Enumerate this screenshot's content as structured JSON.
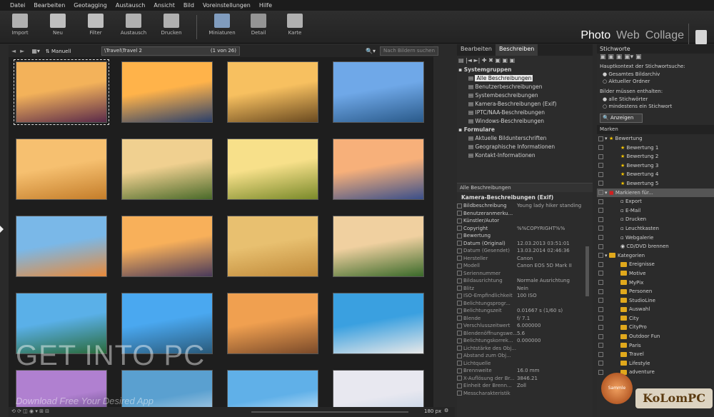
{
  "menu": [
    "Datei",
    "Bearbeiten",
    "Geotagging",
    "Austausch",
    "Ansicht",
    "Bild",
    "Voreinstellungen",
    "Hilfe"
  ],
  "toolbar": [
    {
      "label": "Import",
      "icon": "import-icon"
    },
    {
      "label": "Neu",
      "icon": "new-folder-icon"
    },
    {
      "label": "Filter",
      "icon": "filter-icon"
    },
    {
      "label": "Austausch",
      "icon": "exchange-icon"
    },
    {
      "label": "Drucken",
      "icon": "print-icon"
    },
    {
      "label": "Miniaturen",
      "icon": "thumbnails-icon"
    },
    {
      "label": "Detail",
      "icon": "detail-icon"
    },
    {
      "label": "Karte",
      "icon": "map-icon"
    }
  ],
  "modes": {
    "photo": "Photo",
    "web": "Web",
    "collage": "Collage"
  },
  "nav": {
    "sort": "Manuell",
    "path": "\\Travel\\Travel 2",
    "count": "(1 von 26)",
    "search_placeholder": "Nach Bildern suchen"
  },
  "thumbs": [
    {
      "c1": "#f3b25a",
      "c2": "#5a2a4a"
    },
    {
      "c1": "#ffb34a",
      "c2": "#2a3f6a"
    },
    {
      "c1": "#f7c060",
      "c2": "#6a4a20"
    },
    {
      "c1": "#6fa8e8",
      "c2": "#2a5a8a"
    },
    {
      "c1": "#f6c070",
      "c2": "#c47d2a"
    },
    {
      "c1": "#f0d090",
      "c2": "#4a6a2a"
    },
    {
      "c1": "#f7e08a",
      "c2": "#7a8a2a"
    },
    {
      "c1": "#f7b07a",
      "c2": "#3a4f8a"
    },
    {
      "c1": "#7ab8e8",
      "c2": "#e88a3a"
    },
    {
      "c1": "#f8b05a",
      "c2": "#4a3a5a"
    },
    {
      "c1": "#e8c070",
      "c2": "#c08a3a"
    },
    {
      "c1": "#f0d0a0",
      "c2": "#3a6a2a"
    },
    {
      "c1": "#5ab0e8",
      "c2": "#2a6a3a"
    },
    {
      "c1": "#4aa8f0",
      "c2": "#2a5a7a"
    },
    {
      "c1": "#f0a050",
      "c2": "#7a4a2a"
    },
    {
      "c1": "#3aa0e0",
      "c2": "#e8e8e8"
    },
    {
      "c1": "#b080d0",
      "c2": "#3a2a5a"
    },
    {
      "c1": "#5aa0d0",
      "c2": "#e0e8f0"
    },
    {
      "c1": "#60b0e8",
      "c2": "#ffffff"
    },
    {
      "c1": "#e8e8f0",
      "c2": "#b0c8e0"
    }
  ],
  "tabs": {
    "edit": "Bearbeiten",
    "describe": "Beschreiben"
  },
  "tree": [
    {
      "t": "Systemgruppen",
      "lvl": 0
    },
    {
      "t": "Alle Beschreibungen",
      "lvl": 1,
      "sel": true
    },
    {
      "t": "Benutzerbeschreibungen",
      "lvl": 1
    },
    {
      "t": "Systembeschreibungen",
      "lvl": 1
    },
    {
      "t": "Kamera-Beschreibungen (Exif)",
      "lvl": 1
    },
    {
      "t": "IPTC/NAA-Beschreibungen",
      "lvl": 1
    },
    {
      "t": "Windows-Beschreibungen",
      "lvl": 1
    },
    {
      "t": "Formulare",
      "lvl": 0
    },
    {
      "t": "Aktuelle Bildunterschriften",
      "lvl": 1
    },
    {
      "t": "Geographische Informationen",
      "lvl": 1
    },
    {
      "t": "Kontakt-Informationen",
      "lvl": 1
    }
  ],
  "all_desc": "Alle Beschreibungen",
  "exif_header": "Kamera-Beschreibungen (Exif)",
  "exif": [
    [
      "Bildbeschreibung",
      "Young lady hiker standing"
    ],
    [
      "Benutzeranmerku...",
      ""
    ],
    [
      "Künstler/Autor",
      ""
    ],
    [
      "Copyright",
      "%%COPYRIGHT%%"
    ],
    [
      "Bewertung",
      ""
    ],
    [
      "Datum (Original)",
      "12.03.2013 03:51:01"
    ],
    [
      "Datum (Gesendet)",
      "13.03.2014 02:46:36"
    ],
    [
      "Hersteller",
      "Canon"
    ],
    [
      "Modell",
      "Canon EOS 5D Mark II"
    ],
    [
      "Seriennummer",
      ""
    ],
    [
      "Bildausrichtung",
      "Normale Ausrichtung"
    ],
    [
      "Blitz",
      "Nein"
    ],
    [
      "ISO-Empfindlichkeit",
      "100 ISO"
    ],
    [
      "Belichtungsprogr...",
      ""
    ],
    [
      "Belichtungszeit",
      "0.01667 s (1/60 s)"
    ],
    [
      "Blende",
      "f/ 7.1"
    ],
    [
      "Verschlusszeitwert",
      "6.000000"
    ],
    [
      "Blendenöffnungswe...",
      "5.6"
    ],
    [
      "Belichtungskorrek...",
      "0.000000"
    ],
    [
      "Lichtstärke des Obj...",
      ""
    ],
    [
      "Abstand zum Obj...",
      ""
    ],
    [
      "Lichtquelle",
      ""
    ],
    [
      "Brennweite",
      "16.0 mm"
    ],
    [
      "X-Auflösung der Br...",
      "3846.21"
    ],
    [
      "Einheit der Brenn...",
      "Zoll"
    ],
    [
      "Messcharakteristik",
      ""
    ]
  ],
  "right": {
    "title": "Stichworte",
    "main_kw": "Hauptkontext der Stichwortsuche:",
    "r1": "Gesamtes Bildarchiv",
    "r2": "Aktueller Ordner",
    "cond": "Bilder müssen enthalten:",
    "r3": "alle Stichwörter",
    "r4": "mindestens ein Stichwort",
    "show": "Anzeigen",
    "markers": "Marken",
    "items": [
      {
        "t": "Bewertung",
        "k": "star",
        "lvl": 0
      },
      {
        "t": "Bewertung 1",
        "k": "star",
        "lvl": 1
      },
      {
        "t": "Bewertung 2",
        "k": "star",
        "lvl": 1
      },
      {
        "t": "Bewertung 3",
        "k": "star",
        "lvl": 1
      },
      {
        "t": "Bewertung 4",
        "k": "star",
        "lvl": 1
      },
      {
        "t": "Bewertung 5",
        "k": "star",
        "lvl": 1
      },
      {
        "t": "Markieren für...",
        "k": "red",
        "lvl": 0
      },
      {
        "t": "Export",
        "k": "doc",
        "lvl": 1
      },
      {
        "t": "E-Mail",
        "k": "doc",
        "lvl": 1
      },
      {
        "t": "Drucken",
        "k": "doc",
        "lvl": 1
      },
      {
        "t": "Leuchtkasten",
        "k": "doc",
        "lvl": 1
      },
      {
        "t": "Webgalerie",
        "k": "doc",
        "lvl": 1
      },
      {
        "t": "CD/DVD brennen",
        "k": "disc",
        "lvl": 1
      },
      {
        "t": "Kategorien",
        "k": "fold",
        "lvl": 0
      },
      {
        "t": "Ereignisse",
        "k": "fold",
        "lvl": 1
      },
      {
        "t": "Motive",
        "k": "fold",
        "lvl": 1
      },
      {
        "t": "MyPix",
        "k": "fold",
        "lvl": 1
      },
      {
        "t": "Personen",
        "k": "fold",
        "lvl": 1
      },
      {
        "t": "StudioLine",
        "k": "fold",
        "lvl": 1
      },
      {
        "t": "Auswahl",
        "k": "fold",
        "lvl": 1
      },
      {
        "t": "City",
        "k": "fold",
        "lvl": 1
      },
      {
        "t": "CityPro",
        "k": "fold",
        "lvl": 1
      },
      {
        "t": "Outdoor Fun",
        "k": "fold",
        "lvl": 1
      },
      {
        "t": "Paris",
        "k": "fold",
        "lvl": 1
      },
      {
        "t": "Travel",
        "k": "fold",
        "lvl": 1
      },
      {
        "t": "Lifestyle",
        "k": "fold",
        "lvl": 1
      },
      {
        "t": "adventure",
        "k": "fold",
        "lvl": 1
      }
    ]
  },
  "bottom": {
    "zoom": "180 px"
  },
  "watermark": {
    "main": "GET INTO PC",
    "sub": "Download Free Your Desired App",
    "kolom": "KoLomPC",
    "badge": "Sammle Stichw"
  }
}
